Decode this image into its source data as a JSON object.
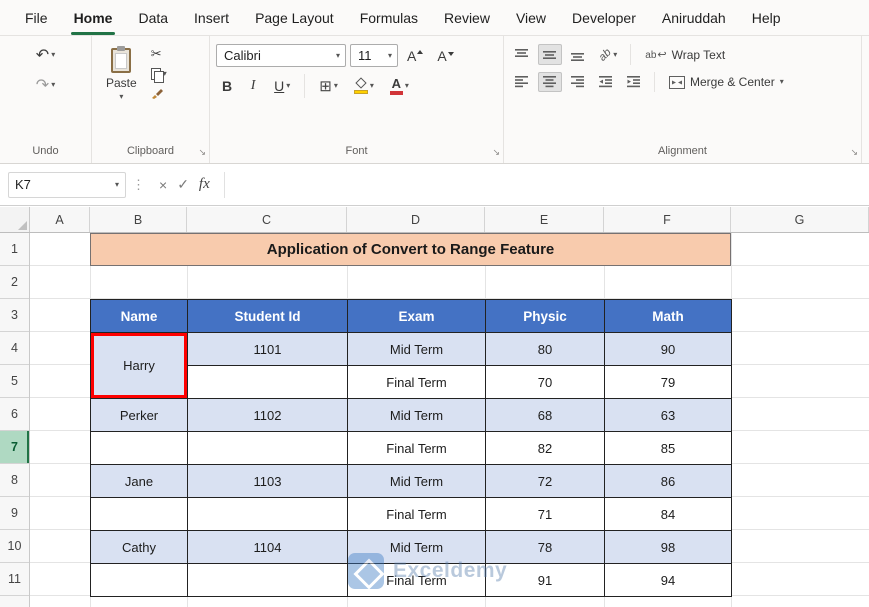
{
  "tabs": {
    "items": [
      "File",
      "Home",
      "Data",
      "Insert",
      "Page Layout",
      "Formulas",
      "Review",
      "View",
      "Developer",
      "Aniruddah",
      "Help"
    ],
    "active": "Home"
  },
  "ribbon": {
    "undo": {
      "label": "Undo"
    },
    "clipboard": {
      "label": "Clipboard",
      "paste_label": "Paste"
    },
    "font": {
      "label": "Font",
      "family": "Calibri",
      "size": "11",
      "bold": "B",
      "italic": "I",
      "underline": "U",
      "grow": "A",
      "shrink": "A"
    },
    "alignment": {
      "label": "Alignment",
      "wrap_text_label": "Wrap Text",
      "merge_center_label": "Merge & Center"
    }
  },
  "formula_bar": {
    "name_box": "K7",
    "fx": "fx",
    "value": ""
  },
  "icons": {
    "undo": "↶",
    "redo": "↷",
    "caret": "▾",
    "cut": "✂",
    "borders": "⊞",
    "cancel": "×",
    "confirm": "✓",
    "resizer": "⋮",
    "launcher": "↘",
    "wrap_ab": "ab",
    "wrap_return": "↩",
    "orientation": "ab"
  },
  "grid": {
    "col_headers": [
      "A",
      "B",
      "C",
      "D",
      "E",
      "F",
      "G"
    ],
    "row_headers": [
      "1",
      "2",
      "3",
      "4",
      "5",
      "6",
      "7",
      "8",
      "9",
      "10",
      "11"
    ],
    "selected_row": "7"
  },
  "sheet": {
    "banner": "Application of Convert to Range Feature",
    "table": {
      "headers": [
        "Name",
        "Student Id",
        "Exam",
        "Physic",
        "Math"
      ],
      "rows": [
        {
          "name": "Harry",
          "id": "1101",
          "exam": "Mid Term",
          "physic": "80",
          "math": "90"
        },
        {
          "name": "",
          "id": "",
          "exam": "Final Term",
          "physic": "70",
          "math": "79"
        },
        {
          "name": "Perker",
          "id": "1102",
          "exam": "Mid Term",
          "physic": "68",
          "math": "63"
        },
        {
          "name": "",
          "id": "",
          "exam": "Final Term",
          "physic": "82",
          "math": "85"
        },
        {
          "name": "Jane",
          "id": "1103",
          "exam": "Mid Term",
          "physic": "72",
          "math": "86"
        },
        {
          "name": "",
          "id": "",
          "exam": "Final Term",
          "physic": "71",
          "math": "84"
        },
        {
          "name": "Cathy",
          "id": "1104",
          "exam": "Mid Term",
          "physic": "78",
          "math": "98"
        },
        {
          "name": "",
          "id": "",
          "exam": "Final Term",
          "physic": "91",
          "math": "94"
        }
      ]
    },
    "watermark": "Exceldemy"
  },
  "colors": {
    "excel_green": "#217346",
    "table_header_blue": "#4472C4",
    "row_shade": "#D9E1F2",
    "banner_fill": "#F8CBAD",
    "highlight_red": "#FE0000",
    "row_header_selected": "#AFD9C2"
  }
}
